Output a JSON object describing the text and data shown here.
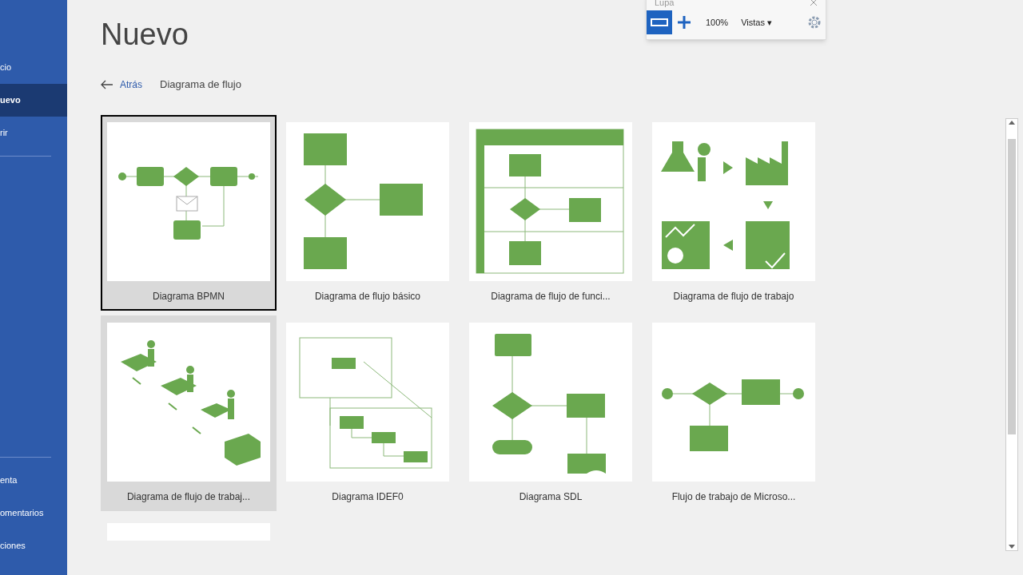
{
  "sidebar": {
    "items": [
      {
        "label": "cio",
        "selected": false
      },
      {
        "label": "uevo",
        "selected": true
      },
      {
        "label": "rir",
        "selected": false
      }
    ],
    "footer_items": [
      {
        "label": "enta"
      },
      {
        "label": "omentarios"
      },
      {
        "label": "ciones"
      }
    ]
  },
  "magnifier": {
    "title": "Lupa",
    "zoom": "100%",
    "views": "Vistas ▾"
  },
  "page": {
    "title": "Nuevo",
    "back": "Atrás",
    "breadcrumb": "Diagrama de flujo"
  },
  "templates": [
    {
      "kind": "bpmn",
      "label": "Diagrama BPMN",
      "selected": true,
      "hovered": false
    },
    {
      "kind": "basic",
      "label": "Diagrama de flujo básico",
      "selected": false,
      "hovered": false
    },
    {
      "kind": "cross",
      "label": "Diagrama de flujo de funci...",
      "selected": false,
      "hovered": false
    },
    {
      "kind": "workflow",
      "label": "Diagrama de flujo de trabajo",
      "selected": false,
      "hovered": false
    },
    {
      "kind": "workflow3d",
      "label": "Diagrama de flujo de trabaj...",
      "selected": false,
      "hovered": true
    },
    {
      "kind": "idef0",
      "label": "Diagrama IDEF0",
      "selected": false,
      "hovered": false
    },
    {
      "kind": "sdl",
      "label": "Diagrama SDL",
      "selected": false,
      "hovered": false
    },
    {
      "kind": "msflow",
      "label": "Flujo de trabajo de Microso...",
      "selected": false,
      "hovered": false
    },
    {
      "kind": "blank",
      "selected": false,
      "hovered": false
    }
  ]
}
